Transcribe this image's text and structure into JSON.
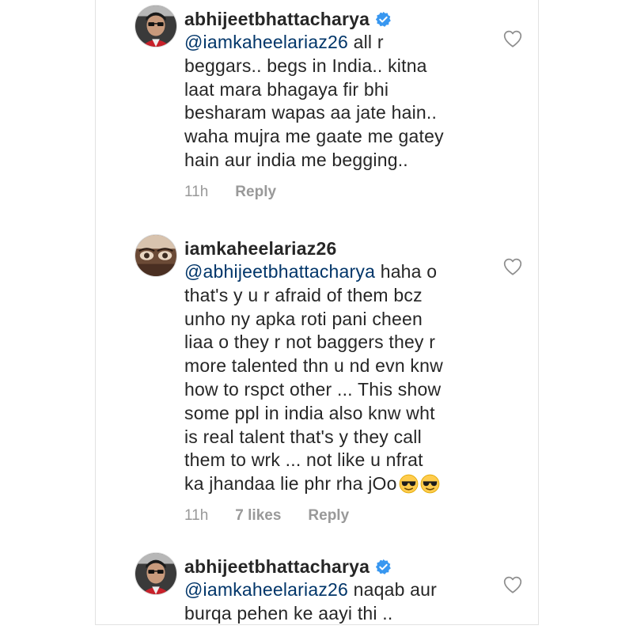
{
  "comments": [
    {
      "username": "abhijeetbhattacharya",
      "verified": true,
      "mention": "@iamkaheelariaz26",
      "lines": [
        " all r",
        "beggars.. begs in India.. kitna",
        "laat mara bhagaya fir bhi",
        "besharam wapas aa jate hain..",
        "waha mujra me gaate me gatey",
        "hain aur india me begging.."
      ],
      "time": "11h",
      "reply": "Reply"
    },
    {
      "username": "iamkaheelariaz26",
      "verified": false,
      "mention": "@abhijeetbhattacharya",
      "lines": [
        " haha o",
        "that's y u r afraid of them bcz",
        "unho ny apka roti pani cheen",
        "liaa o they r not baggers they r",
        "more talented thn u nd evn knw",
        "how to rspct other ... This show",
        "some ppl in india also knw wht",
        "is real talent that's y they call",
        "them to wrk ... not like u nfrat",
        "ka jhandaa lie phr rha jOo"
      ],
      "emoji": "smiling-face-with-sunglasses",
      "time": "11h",
      "likes": "7 likes",
      "reply": "Reply"
    },
    {
      "username": "abhijeetbhattacharya",
      "verified": true,
      "mention": "@iamkaheelariaz26",
      "lines": [
        " naqab aur",
        "burqa pehen ke aayi thi .."
      ]
    }
  ],
  "colors": {
    "mention": "#003569",
    "verified": "#3897f0",
    "meta": "#999999"
  }
}
